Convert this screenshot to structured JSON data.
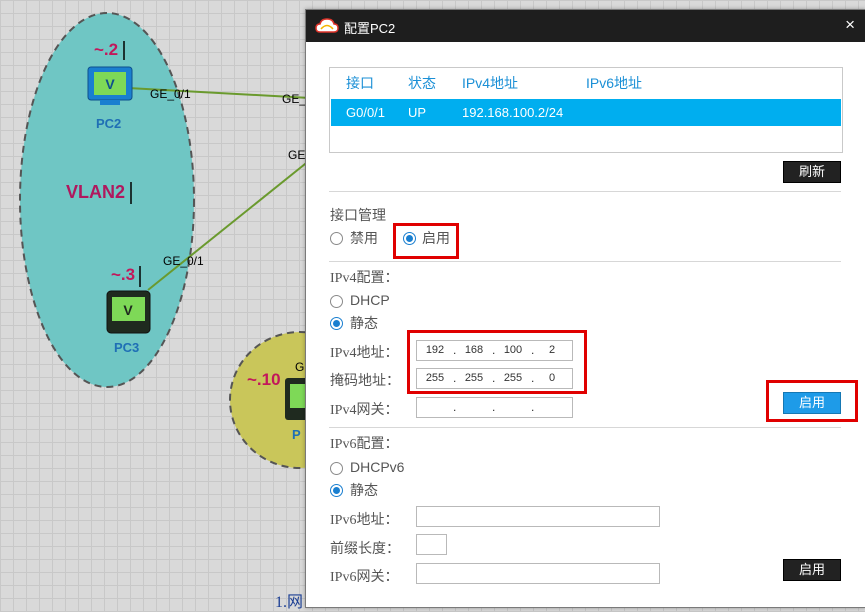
{
  "topology": {
    "vlan_label": "VLAN2",
    "pc2": {
      "name": "PC2",
      "ip_suffix": "~.2",
      "port": "GE_0/1"
    },
    "pc3": {
      "name": "PC3",
      "ip_suffix": "~.3",
      "port": "GE_0/1"
    },
    "switch_ports": [
      "GE_",
      "GE"
    ],
    "pc_other": {
      "ip_suffix": "~.10",
      "name": "P",
      "port": "G"
    },
    "caption": "1.网"
  },
  "dialog": {
    "title": "配置PC2",
    "close": "×",
    "table": {
      "headers": [
        "接口",
        "状态",
        "IPv4地址",
        "IPv6地址"
      ],
      "rows": [
        {
          "interface": "G0/0/1",
          "status": "UP",
          "ipv4": "192.168.100.2/24",
          "ipv6": ""
        }
      ]
    },
    "refresh_button": "刷新",
    "interface_mgmt": {
      "label": "接口管理",
      "disable": "禁用",
      "enable": "启用",
      "selected": "enable"
    },
    "ipv4": {
      "section_label": "IPv4配置：",
      "dhcp": "DHCP",
      "static": "静态",
      "selected": "static",
      "address_label": "IPv4地址：",
      "address": [
        "192",
        "168",
        "100",
        "2"
      ],
      "mask_label": "掩码地址：",
      "mask": [
        "255",
        "255",
        "255",
        "0"
      ],
      "gateway_label": "IPv4网关：",
      "gateway": [
        "",
        "",
        "",
        ""
      ],
      "apply_button": "启用"
    },
    "ipv6": {
      "section_label": "IPv6配置：",
      "dhcp": "DHCPv6",
      "static": "静态",
      "selected": "static",
      "address_label": "IPv6地址：",
      "prefix_label": "前缀长度：",
      "gateway_label": "IPv6网关：",
      "apply_button": "启用"
    }
  },
  "colors": {
    "accent": "#00aeef",
    "highlight": "#e00000",
    "vlan_fill": "#6fc6c4",
    "vlan2_fill": "#c9c65a",
    "link": "#6a9a2e"
  }
}
